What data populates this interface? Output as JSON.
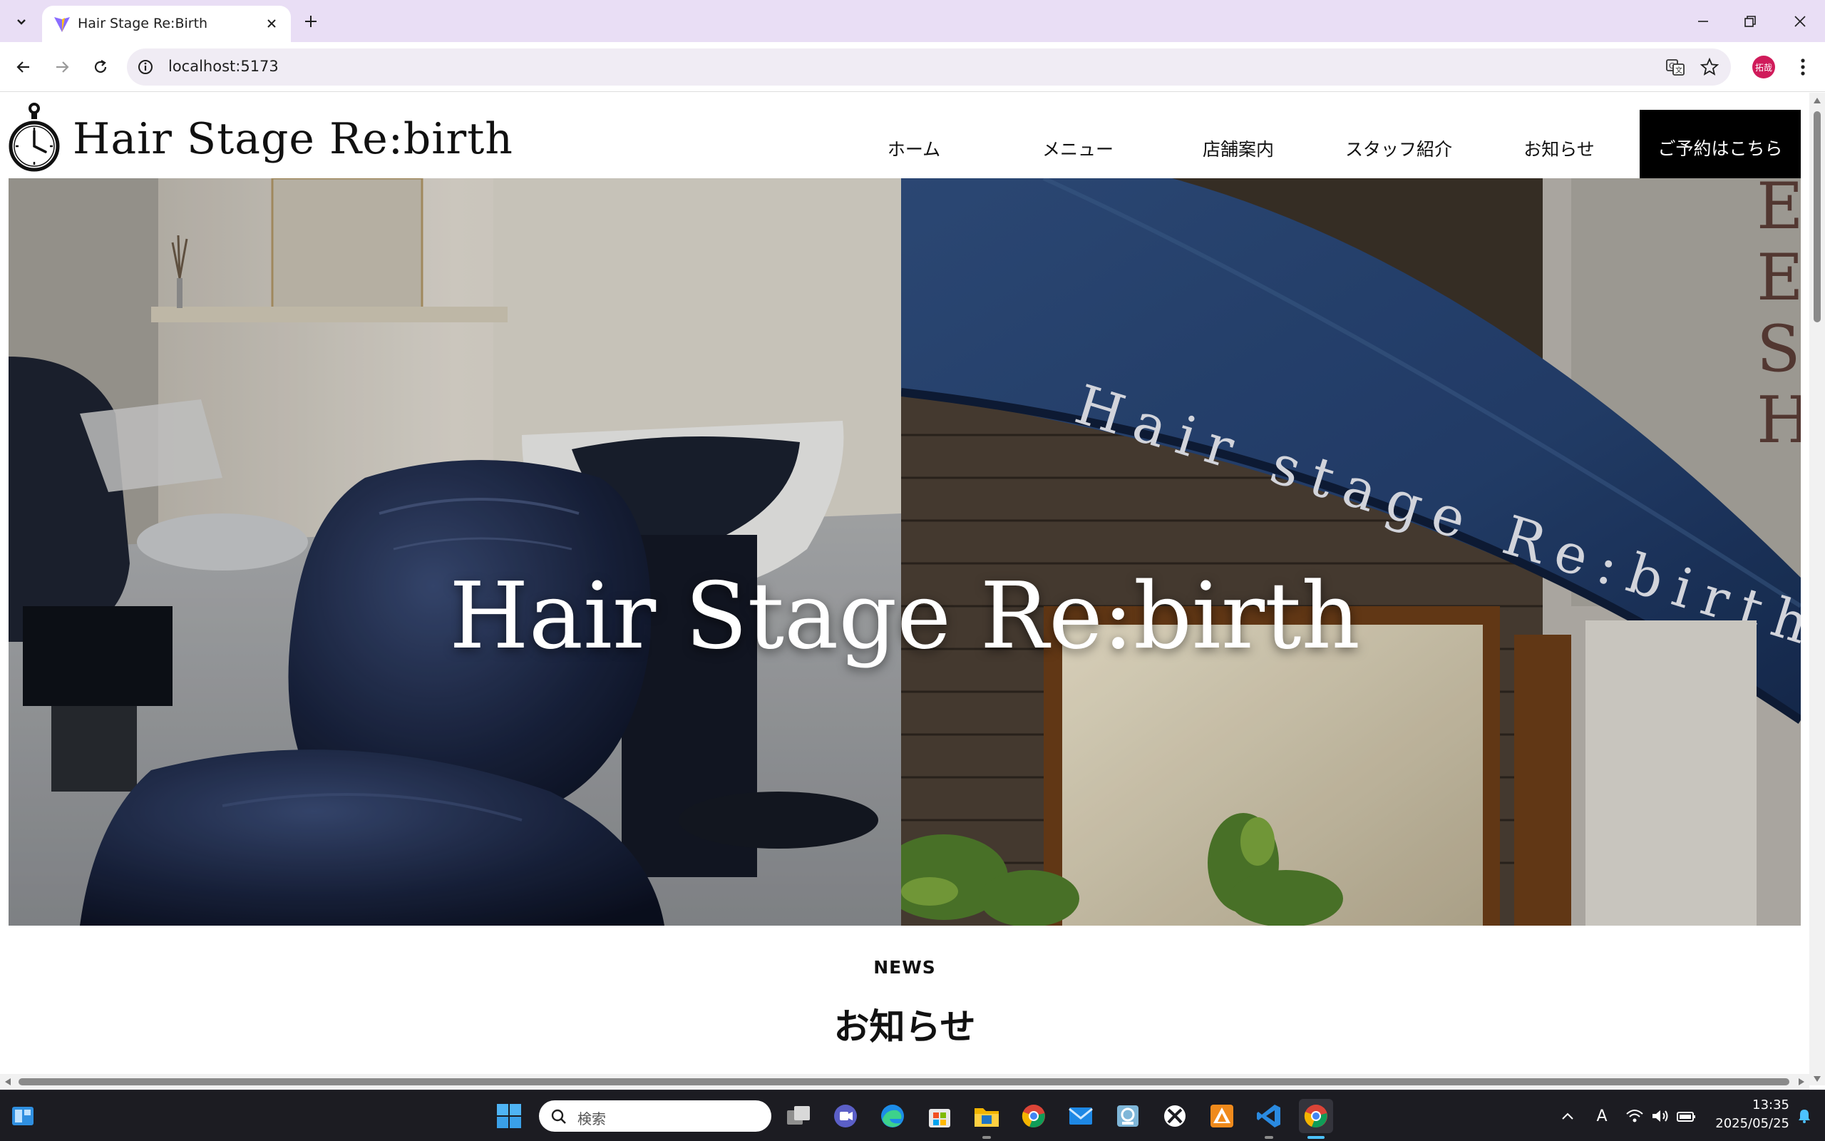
{
  "browser": {
    "tab_title": "Hair Stage Re:Birth",
    "url": "localhost:5173",
    "profile_initials": "拓哉",
    "icons": [
      "tab-search-icon",
      "vite-favicon-icon",
      "close-icon",
      "new-tab-icon",
      "minimize-icon",
      "restore-icon",
      "window-close-icon",
      "back-icon",
      "forward-icon",
      "reload-icon",
      "site-info-icon",
      "translate-icon",
      "bookmark-star-icon",
      "menu-dots-icon"
    ]
  },
  "site": {
    "logo_text": "Hair Stage Re:birth",
    "nav": [
      {
        "label": "ホーム"
      },
      {
        "label": "メニュー"
      },
      {
        "label": "店舗案内"
      },
      {
        "label": "スタッフ紹介"
      },
      {
        "label": "お知らせ"
      }
    ],
    "reserve_label": "ご予約はこちら",
    "hero_title": "Hair Stage Re:birth",
    "awning_text": "Hair stage Re:birth",
    "sign_letters": "ESH",
    "news_label": "NEWS",
    "news_title": "お知らせ"
  },
  "taskbar": {
    "search_placeholder": "検索",
    "ime_label": "A",
    "time": "13:35",
    "date": "2025/05/25"
  },
  "colors": {
    "tabstrip": "#e9def5",
    "omnibox": "#f0ecf4",
    "reserve_button": "#000000",
    "taskbar": "#1c1c22",
    "awning": "#24406e"
  }
}
